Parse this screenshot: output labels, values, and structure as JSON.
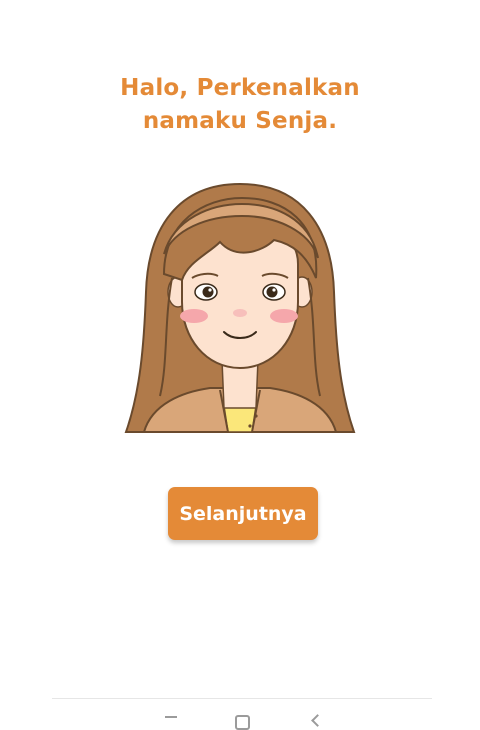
{
  "greeting": {
    "line1": "Halo, Perkenalkan",
    "line2": "namaku Senja."
  },
  "avatar": {
    "icon": "girl-avatar-illustration"
  },
  "next_button": {
    "label": "Selanjutnya"
  },
  "nav": {
    "recents_icon": "recents-icon",
    "home_icon": "home-icon",
    "back_icon": "back-icon"
  },
  "colors": {
    "accent": "#e48a37",
    "hair": "#b07a4a",
    "skin": "#fde2cf",
    "blush": "#f5a7ab",
    "jacket": "#d9a679",
    "shirt": "#fbe77a"
  }
}
